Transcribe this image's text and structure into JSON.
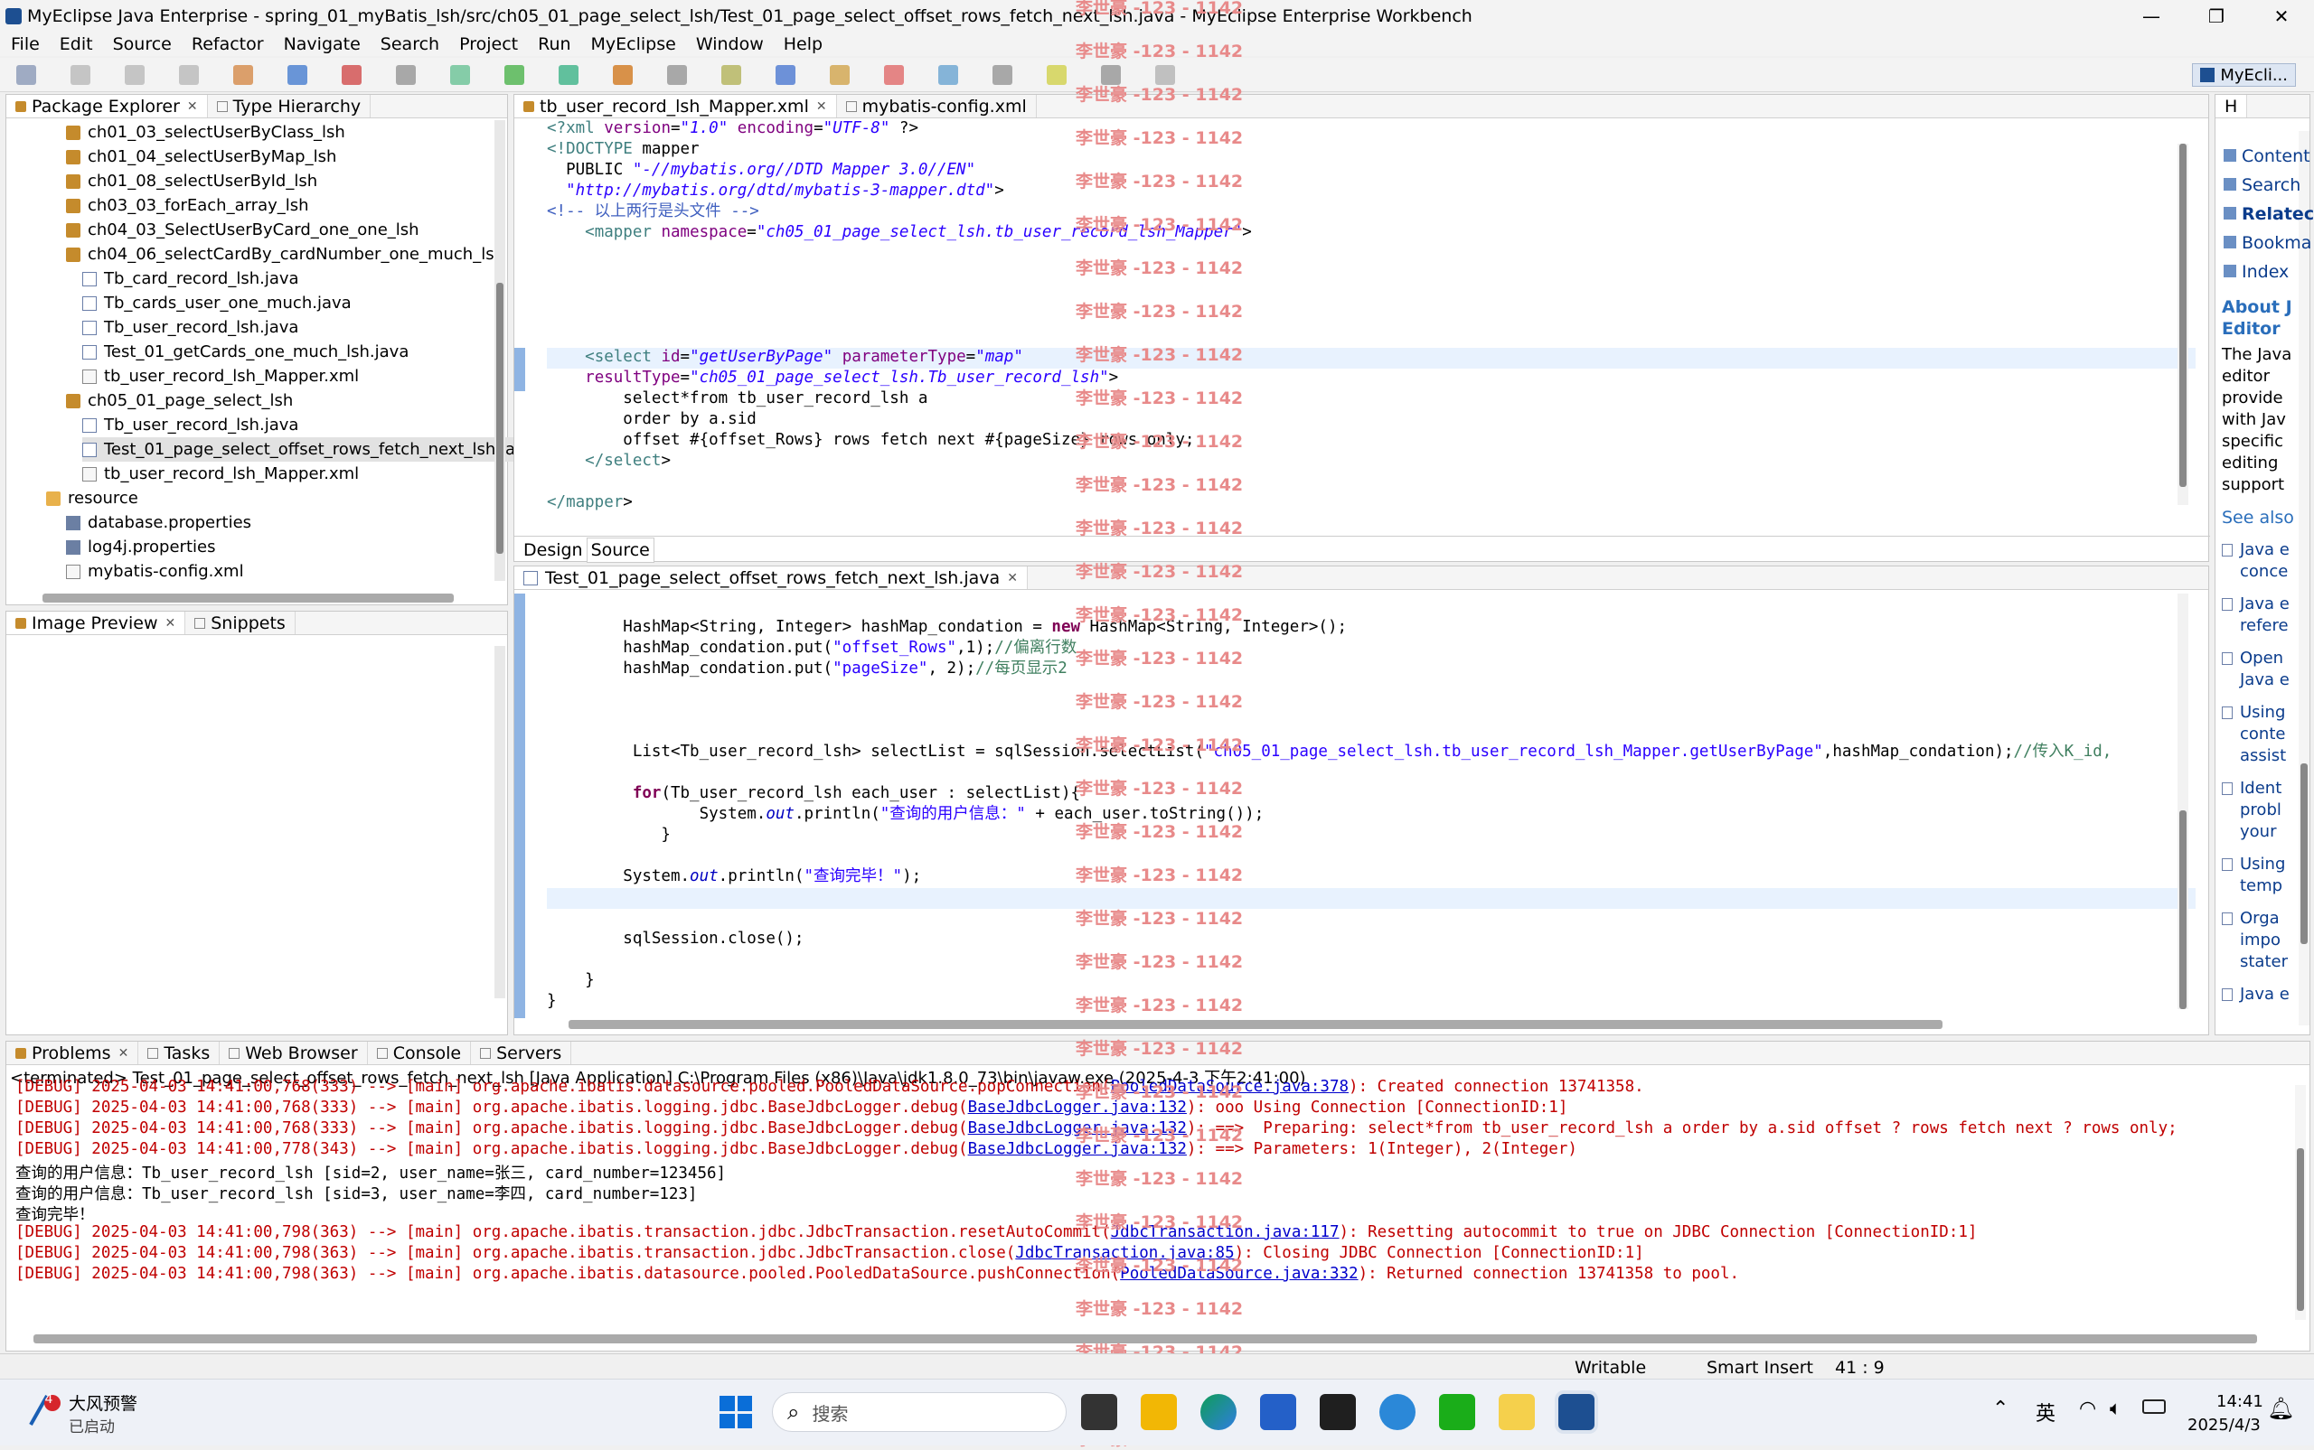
{
  "window": {
    "title": "MyEclipse Java Enterprise - spring_01_myBatis_lsh/src/ch05_01_page_select_lsh/Test_01_page_select_offset_rows_fetch_next_lsh.java - MyEclipse Enterprise Workbench"
  },
  "menu": [
    "File",
    "Edit",
    "Source",
    "Refactor",
    "Navigate",
    "Search",
    "Project",
    "Run",
    "MyEclipse",
    "Window",
    "Help"
  ],
  "perspective": "MyEcli...",
  "package_explorer": {
    "tabs": [
      "Package Explorer",
      "Type Hierarchy"
    ],
    "items": [
      {
        "label": "ch01_03_selectUserByClass_lsh",
        "kind": "pkg",
        "indent": 1
      },
      {
        "label": "ch01_04_selectUserByMap_lsh",
        "kind": "pkg",
        "indent": 1
      },
      {
        "label": "ch01_08_selectUserById_lsh",
        "kind": "pkg",
        "indent": 1
      },
      {
        "label": "ch03_03_forEach_array_lsh",
        "kind": "pkg",
        "indent": 1
      },
      {
        "label": "ch04_03_SelectUserByCard_one_one_lsh",
        "kind": "pkg",
        "indent": 1
      },
      {
        "label": "ch04_06_selectCardBy_cardNumber_one_much_lsh",
        "kind": "pkg",
        "indent": 1
      },
      {
        "label": "Tb_card_record_lsh.java",
        "kind": "java",
        "indent": 2
      },
      {
        "label": "Tb_cards_user_one_much.java",
        "kind": "java",
        "indent": 2
      },
      {
        "label": "Tb_user_record_lsh.java",
        "kind": "java",
        "indent": 2
      },
      {
        "label": "Test_01_getCards_one_much_lsh.java",
        "kind": "java",
        "indent": 2
      },
      {
        "label": "tb_user_record_lsh_Mapper.xml",
        "kind": "xml",
        "indent": 2
      },
      {
        "label": "ch05_01_page_select_lsh",
        "kind": "pkg",
        "indent": 1
      },
      {
        "label": "Tb_user_record_lsh.java",
        "kind": "java",
        "indent": 2
      },
      {
        "label": "Test_01_page_select_offset_rows_fetch_next_lsh.jav",
        "kind": "java",
        "indent": 2,
        "selected": true
      },
      {
        "label": "tb_user_record_lsh_Mapper.xml",
        "kind": "xml",
        "indent": 2
      },
      {
        "label": "resource",
        "kind": "folder",
        "indent": 0
      },
      {
        "label": "database.properties",
        "kind": "prop",
        "indent": 1
      },
      {
        "label": "log4j.properties",
        "kind": "prop",
        "indent": 1
      },
      {
        "label": "mybatis-config.xml",
        "kind": "xml",
        "indent": 1
      }
    ]
  },
  "image_preview": {
    "tabs": [
      "Image Preview",
      "Snippets"
    ]
  },
  "xml_editor": {
    "tabs": [
      "tb_user_record_lsh_Mapper.xml",
      "mybatis-config.xml"
    ],
    "bottom_tabs": [
      "Design",
      "Source"
    ],
    "lines": [
      "<?xml version=\"1.0\" encoding=\"UTF-8\" ?>",
      "<!DOCTYPE mapper",
      "  PUBLIC \"-//mybatis.org//DTD Mapper 3.0//EN\"",
      "  \"http://mybatis.org/dtd/mybatis-3-mapper.dtd\">",
      "<!-- 以上两行是头文件 -->",
      "    <mapper namespace=\"ch05_01_page_select_lsh.tb_user_record_lsh_Mapper\">",
      "",
      "",
      "",
      "",
      "",
      "    <select id=\"getUserByPage\" parameterType=\"map\"",
      "    resultType=\"ch05_01_page_select_lsh.Tb_user_record_lsh\">",
      "        select*from tb_user_record_lsh a",
      "        order by a.sid",
      "        offset #{offset_Rows} rows fetch next #{pageSize} rows only;",
      "    </select>",
      "",
      "</mapper>"
    ]
  },
  "java_editor": {
    "tab": "Test_01_page_select_offset_rows_fetch_next_lsh.java",
    "lines": [
      "        HashMap<String, Integer> hashMap_condation = new HashMap<String, Integer>();",
      "        hashMap_condation.put(\"offset_Rows\",1);//偏离行数",
      "        hashMap_condation.put(\"pageSize\", 2);//每页显示2",
      "",
      "",
      "",
      "         List<Tb_user_record_lsh> selectList = sqlSession.selectList(\"ch05_01_page_select_lsh.tb_user_record_lsh_Mapper.getUserByPage\",hashMap_condation);//传入K_id,",
      "",
      "         for(Tb_user_record_lsh each_user : selectList){",
      "                System.out.println(\"查询的用户信息：\" + each_user.toString());",
      "            }",
      "",
      "        System.out.println(\"查询完毕！\");",
      "",
      "",
      "        sqlSession.close();",
      "",
      "    }",
      "}"
    ]
  },
  "help_panel": {
    "tab": "H",
    "items": [
      "Content",
      "Search",
      "Relatec",
      "Bookma",
      "Index"
    ],
    "about_title": "About J Editor",
    "about_text": [
      "The Java",
      "editor",
      "provide",
      "with Jav",
      "specific",
      "editing",
      "support"
    ],
    "see_also": "See also",
    "links": [
      [
        "Java e",
        "conce"
      ],
      [
        "Java e",
        "refere"
      ],
      [
        "Open",
        "Java e"
      ],
      [
        "Using",
        "conte",
        "assist"
      ],
      [
        "Ident",
        "probl",
        "your"
      ],
      [
        "Using",
        "temp"
      ],
      [
        "Orga",
        "impo",
        "stater"
      ],
      [
        "Java e"
      ]
    ]
  },
  "console": {
    "tabs": [
      "Problems",
      "Tasks",
      "Web Browser",
      "Console",
      "Servers"
    ],
    "header": "<terminated> Test_01_page_select_offset_rows_fetch_next_lsh [Java Application] C:\\Program Files (x86)\\Java\\jdk1.8.0_73\\bin\\javaw.exe (2025-4-3 下午2:41:00)",
    "lines": [
      {
        "pre": "[DEBUG] 2025-04-03 14:41:00,768(333) --> [main] org.apache.ibatis.datasource.pooled.PooledDataSource.popConnection(",
        "link": "PooledDataSource.java:378",
        "post": "): Created connection 13741358.",
        "out": false
      },
      {
        "pre": "[DEBUG] 2025-04-03 14:41:00,768(333) --> [main] org.apache.ibatis.logging.jdbc.BaseJdbcLogger.debug(",
        "link": "BaseJdbcLogger.java:132",
        "post": "): ooo Using Connection [ConnectionID:1]",
        "out": false
      },
      {
        "pre": "[DEBUG] 2025-04-03 14:41:00,768(333) --> [main] org.apache.ibatis.logging.jdbc.BaseJdbcLogger.debug(",
        "link": "BaseJdbcLogger.java:132",
        "post": "): ==>  Preparing: select*from tb_user_record_lsh a order by a.sid offset ? rows fetch next ? rows only;",
        "out": false
      },
      {
        "pre": "[DEBUG] 2025-04-03 14:41:00,778(343) --> [main] org.apache.ibatis.logging.jdbc.BaseJdbcLogger.debug(",
        "link": "BaseJdbcLogger.java:132",
        "post": "): ==> Parameters: 1(Integer), 2(Integer)",
        "out": false
      },
      {
        "pre": "查询的用户信息：Tb_user_record_lsh [sid=2, user_name=张三, card_number=123456]",
        "link": "",
        "post": "",
        "out": true
      },
      {
        "pre": "查询的用户信息：Tb_user_record_lsh [sid=3, user_name=李四, card_number=123]",
        "link": "",
        "post": "",
        "out": true
      },
      {
        "pre": "查询完毕！",
        "link": "",
        "post": "",
        "out": true
      },
      {
        "pre": "[DEBUG] 2025-04-03 14:41:00,798(363) --> [main] org.apache.ibatis.transaction.jdbc.JdbcTransaction.resetAutoCommit(",
        "link": "JdbcTransaction.java:117",
        "post": "): Resetting autocommit to true on JDBC Connection [ConnectionID:1]",
        "out": false
      },
      {
        "pre": "[DEBUG] 2025-04-03 14:41:00,798(363) --> [main] org.apache.ibatis.transaction.jdbc.JdbcTransaction.close(",
        "link": "JdbcTransaction.java:85",
        "post": "): Closing JDBC Connection [ConnectionID:1]",
        "out": false
      },
      {
        "pre": "[DEBUG] 2025-04-03 14:41:00,798(363) --> [main] org.apache.ibatis.datasource.pooled.PooledDataSource.pushConnection(",
        "link": "PooledDataSource.java:332",
        "post": "): Returned connection 13741358 to pool.",
        "out": false
      }
    ]
  },
  "status": {
    "writable": "Writable",
    "insert": "Smart Insert",
    "position": "41 : 9"
  },
  "watermark": "李世豪 -123 - 1142",
  "taskbar": {
    "weather_badge": "4",
    "weather_title": "大风预警",
    "weather_sub": "已启动",
    "search_placeholder": "搜索",
    "lang": "英",
    "time": "14:41",
    "date": "2025/4/3"
  }
}
